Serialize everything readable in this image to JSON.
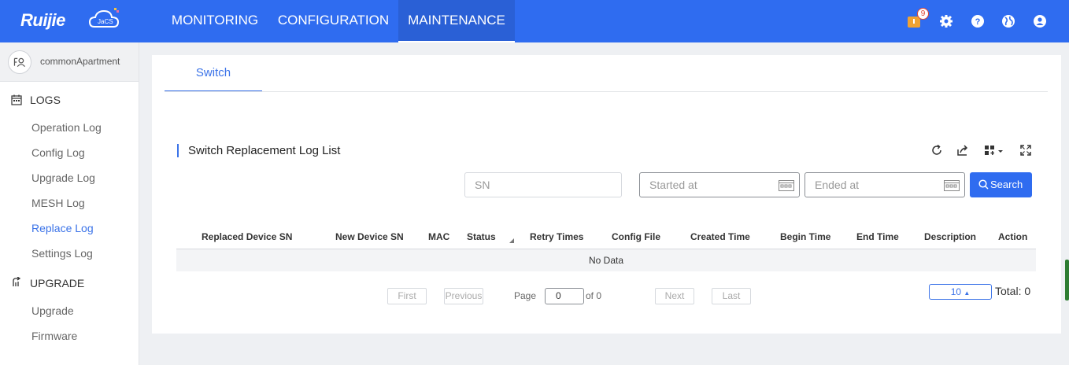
{
  "brand": {
    "name": "Ruijie",
    "badge": "JaCS"
  },
  "nav": {
    "items": [
      {
        "label": "MONITORING"
      },
      {
        "label": "CONFIGURATION"
      },
      {
        "label": "MAINTENANCE"
      }
    ],
    "active": "MAINTENANCE"
  },
  "header_icons": {
    "notification_count": "9",
    "icons": [
      "notification-icon",
      "gear-icon",
      "help-icon",
      "globe-icon",
      "user-icon"
    ]
  },
  "sidebar": {
    "account": "commonApartment",
    "groups": [
      {
        "label": "LOGS",
        "icon": "calendar-icon",
        "items": [
          "Operation Log",
          "Config Log",
          "Upgrade Log",
          "MESH Log",
          "Replace Log",
          "Settings Log"
        ]
      },
      {
        "label": "UPGRADE",
        "icon": "upgrade-icon",
        "items": [
          "Upgrade",
          "Firmware"
        ]
      }
    ],
    "active_item": "Replace Log"
  },
  "main": {
    "tab": "Switch",
    "section_title": "Switch Replacement Log List",
    "toolbar_icons": [
      "refresh-icon",
      "export-icon",
      "columns-icon",
      "fullscreen-icon"
    ],
    "filters": {
      "sn_placeholder": "SN",
      "start_placeholder": "Started at",
      "end_placeholder": "Ended at",
      "search_label": "Search"
    },
    "table": {
      "columns": [
        "Replaced Device SN",
        "New Device SN",
        "MAC",
        "Status",
        "Retry Times",
        "Config File",
        "Created Time",
        "Begin Time",
        "End Time",
        "Description",
        "Action"
      ],
      "empty_text": "No Data"
    },
    "pagination": {
      "first": "First",
      "previous": "Previous",
      "page_label": "Page",
      "page_value": "0",
      "of_text": "of 0",
      "next": "Next",
      "last": "Last",
      "page_size": "10",
      "total": "Total: 0"
    }
  },
  "colors": {
    "primary": "#2f6cf0",
    "accent_text": "#3b73e8",
    "notification": "#f0a233"
  }
}
